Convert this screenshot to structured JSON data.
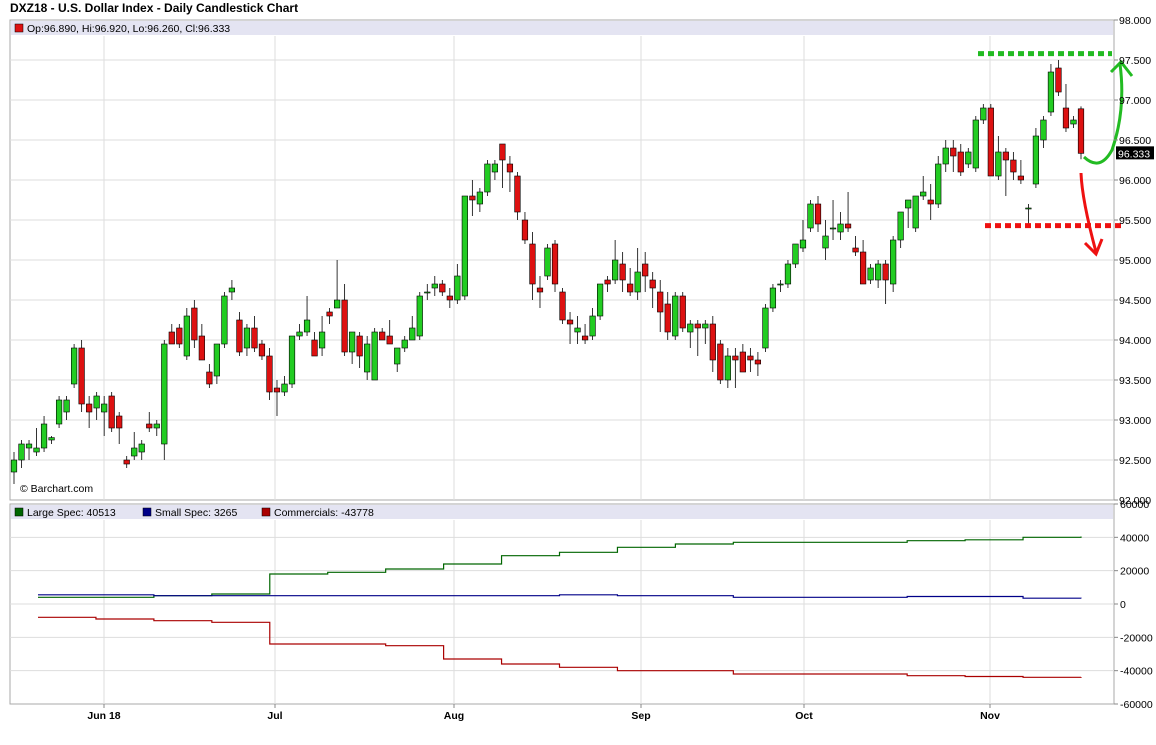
{
  "title": "DXZ18 - U.S. Dollar Index - Daily Candlestick Chart",
  "ohlc_legend": "Op:96.890, Hi:96.920, Lo:96.260, Cl:96.333",
  "last_price_label": "96.333",
  "watermark": "© Barchart.com",
  "colors": {
    "up": "#22cc22",
    "down": "#dd1111",
    "grid": "#dddddd",
    "legend_bg": "#e4e4f2",
    "large_spec": "#006600",
    "small_spec": "#000088",
    "commercials": "#aa0000",
    "annot_green": "#22bb22",
    "annot_red": "#ee1111"
  },
  "chart_data": [
    {
      "type": "candlestick",
      "title": "DXZ18 - U.S. Dollar Index - Daily Candlestick Chart",
      "ylim": [
        92.0,
        98.0
      ],
      "y_ticks": [
        "92.000",
        "92.500",
        "93.000",
        "93.500",
        "94.000",
        "94.500",
        "95.000",
        "95.500",
        "96.000",
        "96.500",
        "97.000",
        "97.500",
        "98.000"
      ],
      "x_tick_labels": [
        "Jun 18",
        "Jul",
        "Aug",
        "Sep",
        "Oct",
        "Nov"
      ],
      "last": {
        "open": 96.89,
        "high": 96.92,
        "low": 96.26,
        "close": 96.333
      },
      "candles": [
        [
          92.35,
          92.6,
          92.2,
          92.5
        ],
        [
          92.5,
          92.75,
          92.4,
          92.7
        ],
        [
          92.65,
          92.75,
          92.5,
          92.7
        ],
        [
          92.6,
          92.9,
          92.55,
          92.65
        ],
        [
          92.65,
          93.05,
          92.6,
          92.95
        ],
        [
          92.75,
          92.8,
          92.7,
          92.78
        ],
        [
          92.95,
          93.3,
          92.9,
          93.25
        ],
        [
          93.1,
          93.3,
          93.0,
          93.25
        ],
        [
          93.45,
          93.95,
          93.4,
          93.9
        ],
        [
          93.9,
          94.0,
          93.1,
          93.2
        ],
        [
          93.2,
          93.3,
          92.9,
          93.1
        ],
        [
          93.15,
          93.35,
          93.0,
          93.3
        ],
        [
          93.1,
          93.3,
          92.8,
          93.2
        ],
        [
          93.3,
          93.35,
          92.85,
          92.9
        ],
        [
          93.05,
          93.1,
          92.7,
          92.9
        ],
        [
          92.5,
          92.55,
          92.4,
          92.45
        ],
        [
          92.55,
          92.85,
          92.5,
          92.65
        ],
        [
          92.6,
          92.75,
          92.5,
          92.7
        ],
        [
          92.95,
          93.1,
          92.85,
          92.9
        ],
        [
          92.9,
          93.0,
          92.8,
          92.95
        ],
        [
          92.7,
          94.0,
          92.5,
          93.95
        ],
        [
          94.1,
          94.2,
          93.95,
          93.95
        ],
        [
          94.15,
          94.2,
          93.9,
          93.95
        ],
        [
          93.8,
          94.4,
          93.75,
          94.3
        ],
        [
          94.4,
          94.5,
          93.9,
          94.0
        ],
        [
          94.05,
          94.2,
          93.75,
          93.75
        ],
        [
          93.6,
          93.7,
          93.4,
          93.45
        ],
        [
          93.55,
          93.8,
          93.45,
          93.95
        ],
        [
          93.95,
          94.6,
          93.9,
          94.55
        ],
        [
          94.6,
          94.75,
          94.5,
          94.65
        ],
        [
          94.25,
          94.35,
          93.8,
          93.85
        ],
        [
          93.9,
          94.2,
          93.8,
          94.15
        ],
        [
          94.15,
          94.3,
          93.85,
          93.9
        ],
        [
          93.95,
          94.0,
          93.75,
          93.8
        ],
        [
          93.8,
          93.9,
          93.25,
          93.35
        ],
        [
          93.4,
          93.5,
          93.05,
          93.35
        ],
        [
          93.35,
          93.55,
          93.3,
          93.45
        ],
        [
          93.45,
          94.05,
          93.4,
          94.05
        ],
        [
          94.05,
          94.2,
          94.0,
          94.1
        ],
        [
          94.1,
          94.55,
          94.05,
          94.25
        ],
        [
          94.0,
          94.1,
          93.8,
          93.8
        ],
        [
          93.9,
          94.3,
          93.8,
          94.1
        ],
        [
          94.35,
          94.4,
          94.2,
          94.3
        ],
        [
          94.4,
          95.0,
          94.4,
          94.5
        ],
        [
          94.5,
          94.7,
          93.8,
          93.85
        ],
        [
          93.85,
          94.0,
          93.7,
          94.1
        ],
        [
          94.05,
          94.1,
          93.65,
          93.8
        ],
        [
          93.6,
          94.05,
          93.5,
          93.95
        ],
        [
          93.5,
          94.15,
          93.5,
          94.1
        ],
        [
          94.1,
          94.15,
          94.0,
          94.0
        ],
        [
          94.05,
          94.25,
          93.95,
          93.95
        ],
        [
          93.7,
          93.85,
          93.6,
          93.9
        ],
        [
          93.9,
          94.05,
          93.85,
          94.0
        ],
        [
          94.0,
          94.3,
          94.0,
          94.15
        ],
        [
          94.05,
          94.6,
          94.0,
          94.55
        ],
        [
          94.6,
          94.7,
          94.5,
          94.6
        ],
        [
          94.65,
          94.8,
          94.55,
          94.7
        ],
        [
          94.7,
          94.75,
          94.55,
          94.6
        ],
        [
          94.55,
          94.65,
          94.4,
          94.5
        ],
        [
          94.5,
          94.95,
          94.45,
          94.8
        ],
        [
          94.55,
          95.0,
          94.5,
          95.8
        ],
        [
          95.8,
          96.0,
          95.55,
          95.75
        ],
        [
          95.7,
          95.9,
          95.6,
          95.85
        ],
        [
          95.85,
          96.25,
          95.8,
          96.2
        ],
        [
          96.1,
          96.25,
          96.0,
          96.2
        ],
        [
          96.45,
          96.45,
          95.9,
          96.25
        ],
        [
          96.2,
          96.3,
          95.85,
          96.1
        ],
        [
          96.05,
          96.1,
          95.5,
          95.6
        ],
        [
          95.5,
          95.6,
          95.2,
          95.25
        ],
        [
          95.2,
          95.35,
          94.5,
          94.7
        ],
        [
          94.65,
          94.8,
          94.4,
          94.6
        ],
        [
          94.8,
          95.2,
          94.75,
          95.15
        ],
        [
          95.2,
          95.25,
          94.6,
          94.7
        ],
        [
          94.6,
          94.65,
          94.2,
          94.25
        ],
        [
          94.25,
          94.35,
          93.95,
          94.2
        ],
        [
          94.1,
          94.3,
          93.95,
          94.15
        ],
        [
          94.05,
          94.2,
          93.95,
          94.0
        ],
        [
          94.05,
          94.4,
          94.0,
          94.3
        ],
        [
          94.3,
          94.7,
          94.25,
          94.7
        ],
        [
          94.75,
          94.8,
          94.6,
          94.7
        ],
        [
          94.75,
          95.25,
          94.7,
          95.0
        ],
        [
          94.95,
          95.1,
          94.6,
          94.75
        ],
        [
          94.7,
          94.9,
          94.55,
          94.6
        ],
        [
          94.6,
          95.15,
          94.5,
          94.85
        ],
        [
          94.95,
          95.1,
          94.6,
          94.8
        ],
        [
          94.75,
          94.85,
          94.4,
          94.65
        ],
        [
          94.6,
          94.75,
          94.1,
          94.35
        ],
        [
          94.45,
          94.6,
          94.0,
          94.1
        ],
        [
          94.05,
          94.6,
          94.0,
          94.55
        ],
        [
          94.55,
          94.6,
          94.1,
          94.15
        ],
        [
          94.1,
          94.25,
          93.9,
          94.2
        ],
        [
          94.2,
          94.25,
          93.8,
          94.15
        ],
        [
          94.15,
          94.25,
          93.95,
          94.2
        ],
        [
          94.2,
          94.3,
          93.6,
          93.75
        ],
        [
          93.95,
          94.0,
          93.45,
          93.5
        ],
        [
          93.5,
          93.9,
          93.4,
          93.8
        ],
        [
          93.8,
          93.9,
          93.4,
          93.75
        ],
        [
          93.85,
          93.95,
          93.6,
          93.6
        ],
        [
          93.8,
          93.9,
          93.6,
          93.75
        ],
        [
          93.75,
          93.85,
          93.55,
          93.7
        ],
        [
          93.9,
          94.45,
          93.85,
          94.4
        ],
        [
          94.4,
          94.7,
          94.35,
          94.65
        ],
        [
          94.7,
          94.75,
          94.6,
          94.7
        ],
        [
          94.7,
          95.0,
          94.65,
          94.95
        ],
        [
          94.95,
          95.2,
          94.9,
          95.2
        ],
        [
          95.15,
          95.5,
          95.1,
          95.25
        ],
        [
          95.4,
          95.75,
          95.35,
          95.7
        ],
        [
          95.7,
          95.8,
          95.35,
          95.45
        ],
        [
          95.15,
          95.5,
          95.0,
          95.3
        ],
        [
          95.4,
          95.75,
          95.25,
          95.4
        ],
        [
          95.35,
          95.6,
          95.25,
          95.45
        ],
        [
          95.45,
          95.85,
          95.35,
          95.4
        ],
        [
          95.15,
          95.3,
          95.05,
          95.1
        ],
        [
          95.1,
          95.25,
          94.7,
          94.7
        ],
        [
          94.75,
          94.95,
          94.7,
          94.9
        ],
        [
          94.75,
          95.0,
          94.65,
          94.95
        ],
        [
          94.95,
          95.0,
          94.45,
          94.75
        ],
        [
          94.7,
          95.3,
          94.6,
          95.25
        ],
        [
          95.25,
          95.6,
          95.15,
          95.6
        ],
        [
          95.65,
          95.75,
          95.4,
          95.75
        ],
        [
          95.4,
          95.8,
          95.35,
          95.8
        ],
        [
          95.8,
          96.05,
          95.75,
          95.85
        ],
        [
          95.75,
          95.95,
          95.5,
          95.7
        ],
        [
          95.7,
          96.3,
          95.65,
          96.2
        ],
        [
          96.2,
          96.5,
          96.1,
          96.4
        ],
        [
          96.4,
          96.5,
          96.1,
          96.3
        ],
        [
          96.35,
          96.45,
          96.05,
          96.1
        ],
        [
          96.2,
          96.4,
          96.15,
          96.35
        ],
        [
          96.15,
          96.8,
          96.1,
          96.75
        ],
        [
          96.75,
          96.95,
          96.7,
          96.9
        ],
        [
          96.9,
          96.95,
          96.05,
          96.05
        ],
        [
          96.05,
          96.55,
          96.0,
          96.35
        ],
        [
          96.35,
          96.4,
          95.8,
          96.25
        ],
        [
          96.25,
          96.35,
          96.0,
          96.1
        ],
        [
          96.05,
          96.25,
          95.95,
          96.0
        ],
        [
          95.65,
          95.7,
          95.4,
          95.65
        ],
        [
          95.95,
          96.65,
          95.9,
          96.55
        ],
        [
          96.5,
          96.8,
          96.4,
          96.75
        ],
        [
          96.85,
          97.45,
          96.8,
          97.35
        ],
        [
          97.4,
          97.5,
          97.05,
          97.1
        ],
        [
          96.9,
          97.2,
          96.6,
          96.65
        ],
        [
          96.7,
          96.8,
          96.65,
          96.75
        ],
        [
          96.89,
          96.92,
          96.26,
          96.333
        ]
      ]
    },
    {
      "type": "line",
      "title": "",
      "ylim": [
        -60000,
        60000
      ],
      "y_ticks": [
        "60000",
        "40000",
        "20000",
        "0",
        "-20000",
        "-40000",
        "-60000"
      ],
      "x_tick_labels": [
        "Jun 18",
        "Jul",
        "Aug",
        "Sep",
        "Oct",
        "Nov"
      ],
      "series": [
        {
          "name": "Large Spec",
          "legend": "Large Spec: 40513",
          "values": [
            4000,
            4000,
            5000,
            6000,
            18000,
            19000,
            21000,
            24000,
            29000,
            31000,
            34000,
            36000,
            37000,
            37000,
            37000,
            38000,
            38500,
            40000,
            40513
          ]
        },
        {
          "name": "Small Spec",
          "legend": "Small Spec: 3265",
          "values": [
            5500,
            5500,
            5000,
            5000,
            5000,
            5000,
            5000,
            5000,
            5000,
            5500,
            5000,
            5000,
            4000,
            4000,
            4000,
            4500,
            4500,
            3500,
            3265
          ]
        },
        {
          "name": "Commercials",
          "legend": "Commercials: -43778",
          "values": [
            -8000,
            -9000,
            -10000,
            -11000,
            -24000,
            -24000,
            -25000,
            -33000,
            -36000,
            -38000,
            -40000,
            -40000,
            -42000,
            -42000,
            -42000,
            -43000,
            -43500,
            -44000,
            -43778
          ]
        }
      ]
    }
  ]
}
